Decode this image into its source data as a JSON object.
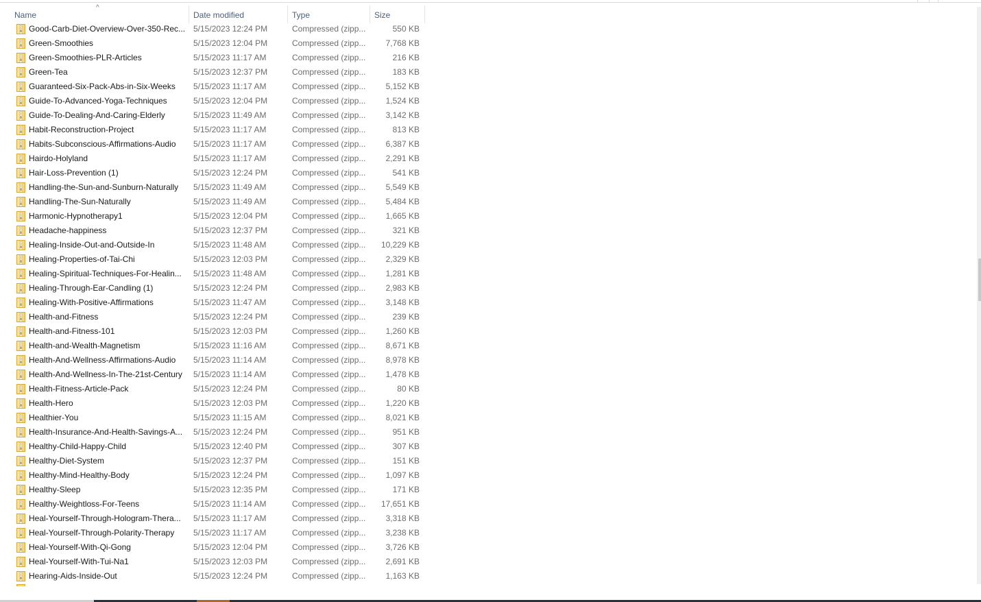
{
  "columns": {
    "name": "Name",
    "date_modified": "Date modified",
    "type": "Type",
    "size": "Size",
    "sort_indicator": "^"
  },
  "file_icon": "zip-folder-icon",
  "files": [
    {
      "name": "Good-Carb-Diet-Overview-Over-350-Rec...",
      "date": "5/15/2023 12:24 PM",
      "type": "Compressed (zipp...",
      "size": "550 KB"
    },
    {
      "name": "Green-Smoothies",
      "date": "5/15/2023 12:04 PM",
      "type": "Compressed (zipp...",
      "size": "7,768 KB"
    },
    {
      "name": "Green-Smoothies-PLR-Articles",
      "date": "5/15/2023 11:17 AM",
      "type": "Compressed (zipp...",
      "size": "216 KB"
    },
    {
      "name": "Green-Tea",
      "date": "5/15/2023 12:37 PM",
      "type": "Compressed (zipp...",
      "size": "183 KB"
    },
    {
      "name": "Guaranteed-Six-Pack-Abs-in-Six-Weeks",
      "date": "5/15/2023 11:17 AM",
      "type": "Compressed (zipp...",
      "size": "5,152 KB"
    },
    {
      "name": "Guide-To-Advanced-Yoga-Techniques",
      "date": "5/15/2023 12:04 PM",
      "type": "Compressed (zipp...",
      "size": "1,524 KB"
    },
    {
      "name": "Guide-To-Dealing-And-Caring-Elderly",
      "date": "5/15/2023 11:49 AM",
      "type": "Compressed (zipp...",
      "size": "3,142 KB"
    },
    {
      "name": "Habit-Reconstruction-Project",
      "date": "5/15/2023 11:17 AM",
      "type": "Compressed (zipp...",
      "size": "813 KB"
    },
    {
      "name": "Habits-Subconscious-Affirmations-Audio",
      "date": "5/15/2023 11:17 AM",
      "type": "Compressed (zipp...",
      "size": "6,387 KB"
    },
    {
      "name": "Hairdo-Holyland",
      "date": "5/15/2023 11:17 AM",
      "type": "Compressed (zipp...",
      "size": "2,291 KB"
    },
    {
      "name": "Hair-Loss-Prevention (1)",
      "date": "5/15/2023 12:24 PM",
      "type": "Compressed (zipp...",
      "size": "541 KB"
    },
    {
      "name": "Handling-the-Sun-and-Sunburn-Naturally",
      "date": "5/15/2023 11:49 AM",
      "type": "Compressed (zipp...",
      "size": "5,549 KB"
    },
    {
      "name": "Handling-The-Sun-Naturally",
      "date": "5/15/2023 11:49 AM",
      "type": "Compressed (zipp...",
      "size": "5,484 KB"
    },
    {
      "name": "Harmonic-Hypnotherapy1",
      "date": "5/15/2023 12:04 PM",
      "type": "Compressed (zipp...",
      "size": "1,665 KB"
    },
    {
      "name": "Headache-happiness",
      "date": "5/15/2023 12:37 PM",
      "type": "Compressed (zipp...",
      "size": "321 KB"
    },
    {
      "name": "Healing-Inside-Out-and-Outside-In",
      "date": "5/15/2023 11:48 AM",
      "type": "Compressed (zipp...",
      "size": "10,229 KB"
    },
    {
      "name": "Healing-Properties-of-Tai-Chi",
      "date": "5/15/2023 12:03 PM",
      "type": "Compressed (zipp...",
      "size": "2,329 KB"
    },
    {
      "name": "Healing-Spiritual-Techniques-For-Healin...",
      "date": "5/15/2023 11:48 AM",
      "type": "Compressed (zipp...",
      "size": "1,281 KB"
    },
    {
      "name": "Healing-Through-Ear-Candling (1)",
      "date": "5/15/2023 12:24 PM",
      "type": "Compressed (zipp...",
      "size": "2,983 KB"
    },
    {
      "name": "Healing-With-Positive-Affirmations",
      "date": "5/15/2023 11:47 AM",
      "type": "Compressed (zipp...",
      "size": "3,148 KB"
    },
    {
      "name": "Health-and-Fitness",
      "date": "5/15/2023 12:24 PM",
      "type": "Compressed (zipp...",
      "size": "239 KB"
    },
    {
      "name": "Health-and-Fitness-101",
      "date": "5/15/2023 12:03 PM",
      "type": "Compressed (zipp...",
      "size": "1,260 KB"
    },
    {
      "name": "Health-and-Wealth-Magnetism",
      "date": "5/15/2023 11:16 AM",
      "type": "Compressed (zipp...",
      "size": "8,671 KB"
    },
    {
      "name": "Health-And-Wellness-Affirmations-Audio",
      "date": "5/15/2023 11:14 AM",
      "type": "Compressed (zipp...",
      "size": "8,978 KB"
    },
    {
      "name": "Health-And-Wellness-In-The-21st-Century",
      "date": "5/15/2023 11:14 AM",
      "type": "Compressed (zipp...",
      "size": "1,478 KB"
    },
    {
      "name": "Health-Fitness-Article-Pack",
      "date": "5/15/2023 12:24 PM",
      "type": "Compressed (zipp...",
      "size": "80 KB"
    },
    {
      "name": "Health-Hero",
      "date": "5/15/2023 12:03 PM",
      "type": "Compressed (zipp...",
      "size": "1,220 KB"
    },
    {
      "name": "Healthier-You",
      "date": "5/15/2023 11:15 AM",
      "type": "Compressed (zipp...",
      "size": "8,021 KB"
    },
    {
      "name": "Health-Insurance-And-Health-Savings-A...",
      "date": "5/15/2023 12:24 PM",
      "type": "Compressed (zipp...",
      "size": "951 KB"
    },
    {
      "name": "Healthy-Child-Happy-Child",
      "date": "5/15/2023 12:40 PM",
      "type": "Compressed (zipp...",
      "size": "307 KB"
    },
    {
      "name": "Healthy-Diet-System",
      "date": "5/15/2023 12:37 PM",
      "type": "Compressed (zipp...",
      "size": "151 KB"
    },
    {
      "name": "Healthy-Mind-Healthy-Body",
      "date": "5/15/2023 12:24 PM",
      "type": "Compressed (zipp...",
      "size": "1,097 KB"
    },
    {
      "name": "Healthy-Sleep",
      "date": "5/15/2023 12:35 PM",
      "type": "Compressed (zipp...",
      "size": "171 KB"
    },
    {
      "name": "Healthy-Weightloss-For-Teens",
      "date": "5/15/2023 11:14 AM",
      "type": "Compressed (zipp...",
      "size": "17,651 KB"
    },
    {
      "name": "Heal-Yourself-Through-Hologram-Thera...",
      "date": "5/15/2023 11:17 AM",
      "type": "Compressed (zipp...",
      "size": "3,318 KB"
    },
    {
      "name": "Heal-Yourself-Through-Polarity-Therapy",
      "date": "5/15/2023 11:17 AM",
      "type": "Compressed (zipp...",
      "size": "3,238 KB"
    },
    {
      "name": "Heal-Yourself-With-Qi-Gong",
      "date": "5/15/2023 12:04 PM",
      "type": "Compressed (zipp...",
      "size": "3,726 KB"
    },
    {
      "name": "Heal-Yourself-With-Tui-Na1",
      "date": "5/15/2023 12:03 PM",
      "type": "Compressed (zipp...",
      "size": "2,691 KB"
    },
    {
      "name": "Hearing-Aids-Inside-Out",
      "date": "5/15/2023 12:24 PM",
      "type": "Compressed (zipp...",
      "size": "1,163 KB"
    }
  ],
  "scrollbar": {
    "vertical_position_fraction": 0.44
  }
}
